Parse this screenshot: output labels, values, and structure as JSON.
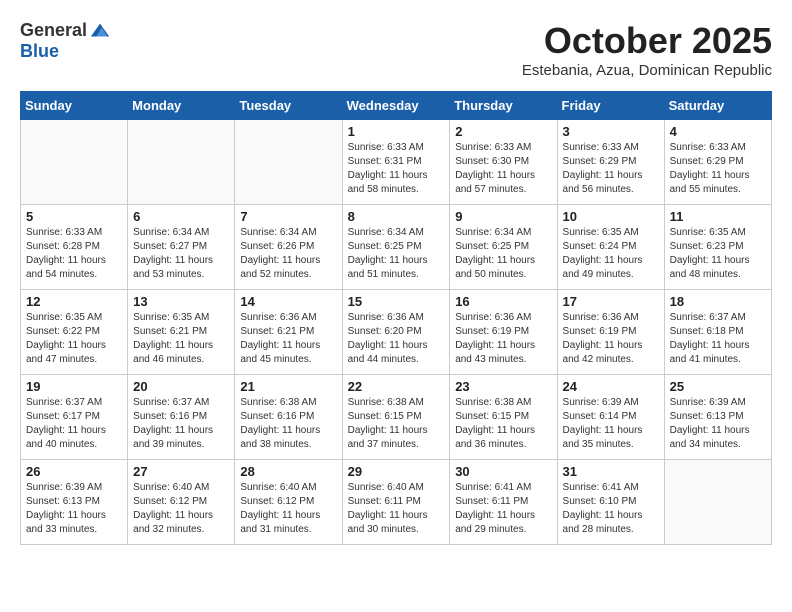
{
  "header": {
    "logo_line1": "General",
    "logo_line2": "Blue",
    "month_title": "October 2025",
    "location": "Estebania, Azua, Dominican Republic"
  },
  "weekdays": [
    "Sunday",
    "Monday",
    "Tuesday",
    "Wednesday",
    "Thursday",
    "Friday",
    "Saturday"
  ],
  "weeks": [
    [
      {
        "day": "",
        "info": ""
      },
      {
        "day": "",
        "info": ""
      },
      {
        "day": "",
        "info": ""
      },
      {
        "day": "1",
        "info": "Sunrise: 6:33 AM\nSunset: 6:31 PM\nDaylight: 11 hours\nand 58 minutes."
      },
      {
        "day": "2",
        "info": "Sunrise: 6:33 AM\nSunset: 6:30 PM\nDaylight: 11 hours\nand 57 minutes."
      },
      {
        "day": "3",
        "info": "Sunrise: 6:33 AM\nSunset: 6:29 PM\nDaylight: 11 hours\nand 56 minutes."
      },
      {
        "day": "4",
        "info": "Sunrise: 6:33 AM\nSunset: 6:29 PM\nDaylight: 11 hours\nand 55 minutes."
      }
    ],
    [
      {
        "day": "5",
        "info": "Sunrise: 6:33 AM\nSunset: 6:28 PM\nDaylight: 11 hours\nand 54 minutes."
      },
      {
        "day": "6",
        "info": "Sunrise: 6:34 AM\nSunset: 6:27 PM\nDaylight: 11 hours\nand 53 minutes."
      },
      {
        "day": "7",
        "info": "Sunrise: 6:34 AM\nSunset: 6:26 PM\nDaylight: 11 hours\nand 52 minutes."
      },
      {
        "day": "8",
        "info": "Sunrise: 6:34 AM\nSunset: 6:25 PM\nDaylight: 11 hours\nand 51 minutes."
      },
      {
        "day": "9",
        "info": "Sunrise: 6:34 AM\nSunset: 6:25 PM\nDaylight: 11 hours\nand 50 minutes."
      },
      {
        "day": "10",
        "info": "Sunrise: 6:35 AM\nSunset: 6:24 PM\nDaylight: 11 hours\nand 49 minutes."
      },
      {
        "day": "11",
        "info": "Sunrise: 6:35 AM\nSunset: 6:23 PM\nDaylight: 11 hours\nand 48 minutes."
      }
    ],
    [
      {
        "day": "12",
        "info": "Sunrise: 6:35 AM\nSunset: 6:22 PM\nDaylight: 11 hours\nand 47 minutes."
      },
      {
        "day": "13",
        "info": "Sunrise: 6:35 AM\nSunset: 6:21 PM\nDaylight: 11 hours\nand 46 minutes."
      },
      {
        "day": "14",
        "info": "Sunrise: 6:36 AM\nSunset: 6:21 PM\nDaylight: 11 hours\nand 45 minutes."
      },
      {
        "day": "15",
        "info": "Sunrise: 6:36 AM\nSunset: 6:20 PM\nDaylight: 11 hours\nand 44 minutes."
      },
      {
        "day": "16",
        "info": "Sunrise: 6:36 AM\nSunset: 6:19 PM\nDaylight: 11 hours\nand 43 minutes."
      },
      {
        "day": "17",
        "info": "Sunrise: 6:36 AM\nSunset: 6:19 PM\nDaylight: 11 hours\nand 42 minutes."
      },
      {
        "day": "18",
        "info": "Sunrise: 6:37 AM\nSunset: 6:18 PM\nDaylight: 11 hours\nand 41 minutes."
      }
    ],
    [
      {
        "day": "19",
        "info": "Sunrise: 6:37 AM\nSunset: 6:17 PM\nDaylight: 11 hours\nand 40 minutes."
      },
      {
        "day": "20",
        "info": "Sunrise: 6:37 AM\nSunset: 6:16 PM\nDaylight: 11 hours\nand 39 minutes."
      },
      {
        "day": "21",
        "info": "Sunrise: 6:38 AM\nSunset: 6:16 PM\nDaylight: 11 hours\nand 38 minutes."
      },
      {
        "day": "22",
        "info": "Sunrise: 6:38 AM\nSunset: 6:15 PM\nDaylight: 11 hours\nand 37 minutes."
      },
      {
        "day": "23",
        "info": "Sunrise: 6:38 AM\nSunset: 6:15 PM\nDaylight: 11 hours\nand 36 minutes."
      },
      {
        "day": "24",
        "info": "Sunrise: 6:39 AM\nSunset: 6:14 PM\nDaylight: 11 hours\nand 35 minutes."
      },
      {
        "day": "25",
        "info": "Sunrise: 6:39 AM\nSunset: 6:13 PM\nDaylight: 11 hours\nand 34 minutes."
      }
    ],
    [
      {
        "day": "26",
        "info": "Sunrise: 6:39 AM\nSunset: 6:13 PM\nDaylight: 11 hours\nand 33 minutes."
      },
      {
        "day": "27",
        "info": "Sunrise: 6:40 AM\nSunset: 6:12 PM\nDaylight: 11 hours\nand 32 minutes."
      },
      {
        "day": "28",
        "info": "Sunrise: 6:40 AM\nSunset: 6:12 PM\nDaylight: 11 hours\nand 31 minutes."
      },
      {
        "day": "29",
        "info": "Sunrise: 6:40 AM\nSunset: 6:11 PM\nDaylight: 11 hours\nand 30 minutes."
      },
      {
        "day": "30",
        "info": "Sunrise: 6:41 AM\nSunset: 6:11 PM\nDaylight: 11 hours\nand 29 minutes."
      },
      {
        "day": "31",
        "info": "Sunrise: 6:41 AM\nSunset: 6:10 PM\nDaylight: 11 hours\nand 28 minutes."
      },
      {
        "day": "",
        "info": ""
      }
    ]
  ]
}
